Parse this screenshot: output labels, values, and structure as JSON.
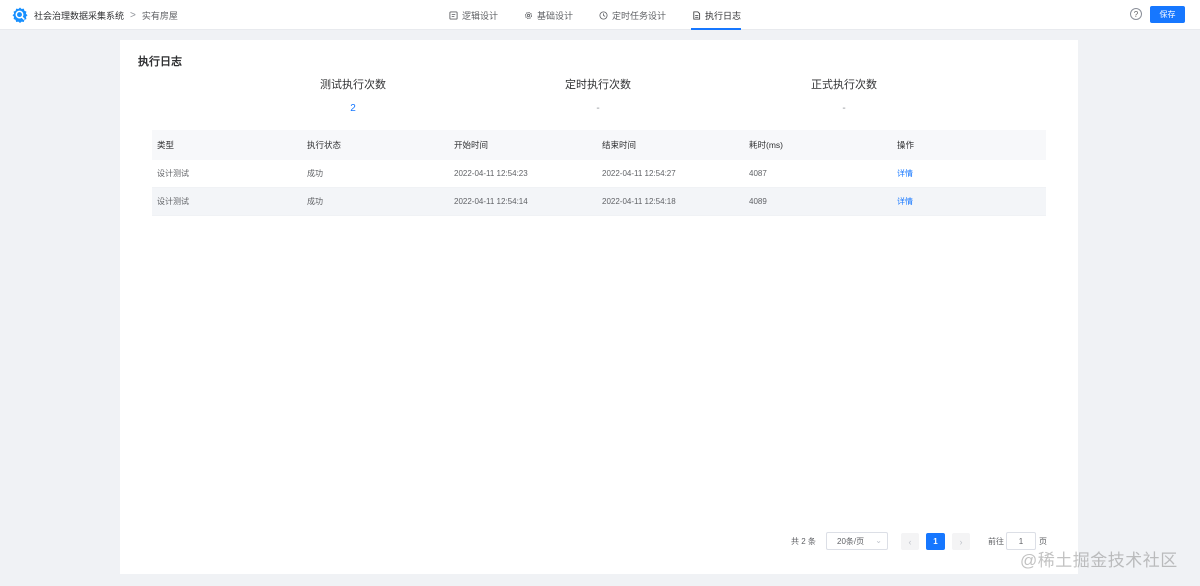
{
  "header": {
    "app_name": "社会治理数据采集系统",
    "breadcrumb_sep": ">",
    "breadcrumb_current": "实有房屋",
    "tabs": [
      {
        "label": "逻辑设计",
        "icon": "document-icon",
        "active": false
      },
      {
        "label": "基础设计",
        "icon": "gear-icon",
        "active": false
      },
      {
        "label": "定时任务设计",
        "icon": "clock-icon",
        "active": false
      },
      {
        "label": "执行日志",
        "icon": "file-icon",
        "active": true
      }
    ],
    "help_label": "?",
    "save_label": "保存"
  },
  "card": {
    "title": "执行日志",
    "stats": [
      {
        "label": "测试执行次数",
        "value": "2"
      },
      {
        "label": "定时执行次数",
        "value": "-"
      },
      {
        "label": "正式执行次数",
        "value": "-"
      }
    ]
  },
  "table": {
    "columns": [
      "类型",
      "执行状态",
      "开始时间",
      "结束时间",
      "耗时(ms)",
      "操作"
    ],
    "rows": [
      [
        "设计测试",
        "成功",
        "2022-04-11 12:54:23",
        "2022-04-11 12:54:27",
        "4087",
        "详情"
      ],
      [
        "设计测试",
        "成功",
        "2022-04-11 12:54:14",
        "2022-04-11 12:54:18",
        "4089",
        "详情"
      ]
    ]
  },
  "pagination": {
    "total": "共 2 条",
    "page_size": "20条/页",
    "prev": "‹",
    "current": "1",
    "next": "›",
    "goto_label": "前往",
    "goto_value": "1",
    "page_suffix": "页"
  },
  "watermark": "@稀土掘金技术社区",
  "colors": {
    "accent": "#1677ff",
    "background": "#f0f2f5"
  }
}
